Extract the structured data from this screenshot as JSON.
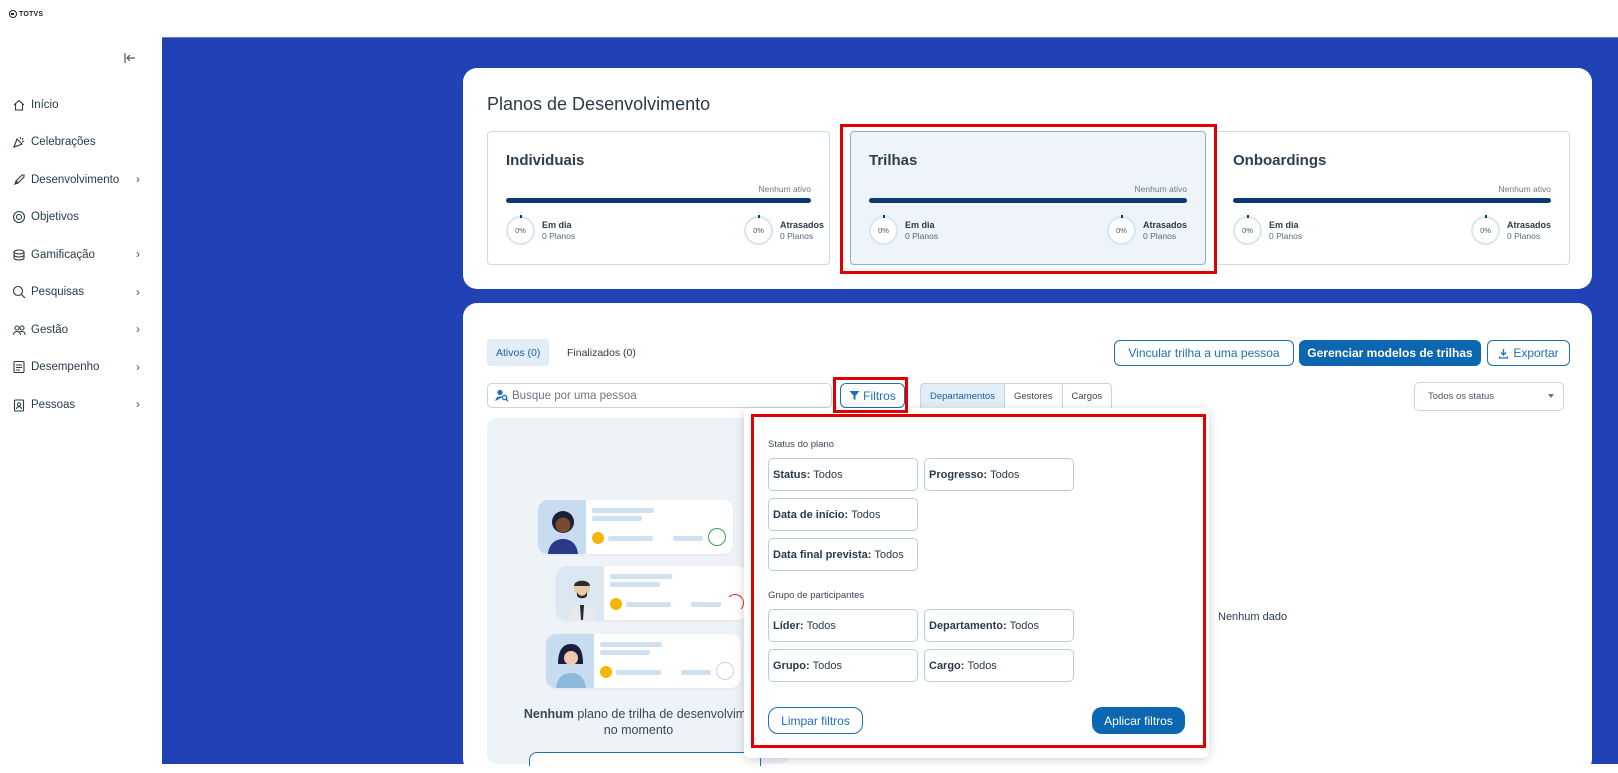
{
  "logo": {
    "text": "TOTVS"
  },
  "sidebar": {
    "collapse_icon": "collapse-left-icon",
    "items": [
      {
        "label": "Início",
        "icon": "home-icon",
        "has_children": false
      },
      {
        "label": "Celebrações",
        "icon": "party-popper-icon",
        "has_children": false
      },
      {
        "label": "Desenvolvimento",
        "icon": "rocket-icon",
        "has_children": true
      },
      {
        "label": "Objetivos",
        "icon": "target-icon",
        "has_children": false
      },
      {
        "label": "Gamificação",
        "icon": "coins-icon",
        "has_children": true
      },
      {
        "label": "Pesquisas",
        "icon": "search-chart-icon",
        "has_children": true
      },
      {
        "label": "Gestão",
        "icon": "users-icon",
        "has_children": true
      },
      {
        "label": "Desempenho",
        "icon": "checklist-icon",
        "has_children": true
      },
      {
        "label": "Pessoas",
        "icon": "id-badge-icon",
        "has_children": true
      }
    ]
  },
  "page": {
    "title": "Planos de Desenvolvimento"
  },
  "plans": [
    {
      "title": "Individuais",
      "status": "Nenhum ativo",
      "metrics": [
        {
          "pct": "0%",
          "label": "Em dia",
          "sub": "0 Planos"
        },
        {
          "pct": "0%",
          "label": "Atrasados",
          "sub": "0 Planos"
        }
      ]
    },
    {
      "title": "Trilhas",
      "status": "Nenhum ativo",
      "metrics": [
        {
          "pct": "0%",
          "label": "Em dia",
          "sub": "0 Planos"
        },
        {
          "pct": "0%",
          "label": "Atrasados",
          "sub": "0 Planos"
        }
      ]
    },
    {
      "title": "Onboardings",
      "status": "Nenhum ativo",
      "metrics": [
        {
          "pct": "0%",
          "label": "Em dia",
          "sub": "0 Planos"
        },
        {
          "pct": "0%",
          "label": "Atrasados",
          "sub": "0 Planos"
        }
      ]
    }
  ],
  "tabs": {
    "active": "Ativos (0)",
    "finished": "Finalizados (0)"
  },
  "actions": {
    "link_trail": "Vincular trilha a uma pessoa",
    "manage_models": "Gerenciar modelos de trilhas",
    "export": "Exportar"
  },
  "search": {
    "placeholder": "Busque por uma pessoa"
  },
  "filters_button": "Filtros",
  "segments": [
    "Departamentos",
    "Gestores",
    "Cargos"
  ],
  "status_select": {
    "value": "Todos os status"
  },
  "empty_state": {
    "bold": "Nenhum",
    "rest": " plano de trilha de desenvolvime",
    "line2": "no momento"
  },
  "no_data": "Nenhum dado",
  "filter_popover": {
    "section_status": "Status do plano",
    "status_label": "Status:",
    "status_value": "Todos",
    "progress_label": "Progresso:",
    "progress_value": "Todos",
    "start_label": "Data de início:",
    "start_value": "Todos",
    "end_label": "Data final prevista:",
    "end_value": "Todos",
    "section_group": "Grupo de participantes",
    "leader_label": "Líder:",
    "leader_value": "Todos",
    "dept_label": "Departamento:",
    "dept_value": "Todos",
    "group_label": "Grupo:",
    "group_value": "Todos",
    "role_label": "Cargo:",
    "role_value": "Todos",
    "clear": "Limpar filtros",
    "apply": "Aplicar filtros"
  },
  "colors": {
    "main_bg": "#2142b5",
    "primary": "#0c66b0",
    "highlight": "#e00000",
    "progress": "#0b3a73"
  }
}
